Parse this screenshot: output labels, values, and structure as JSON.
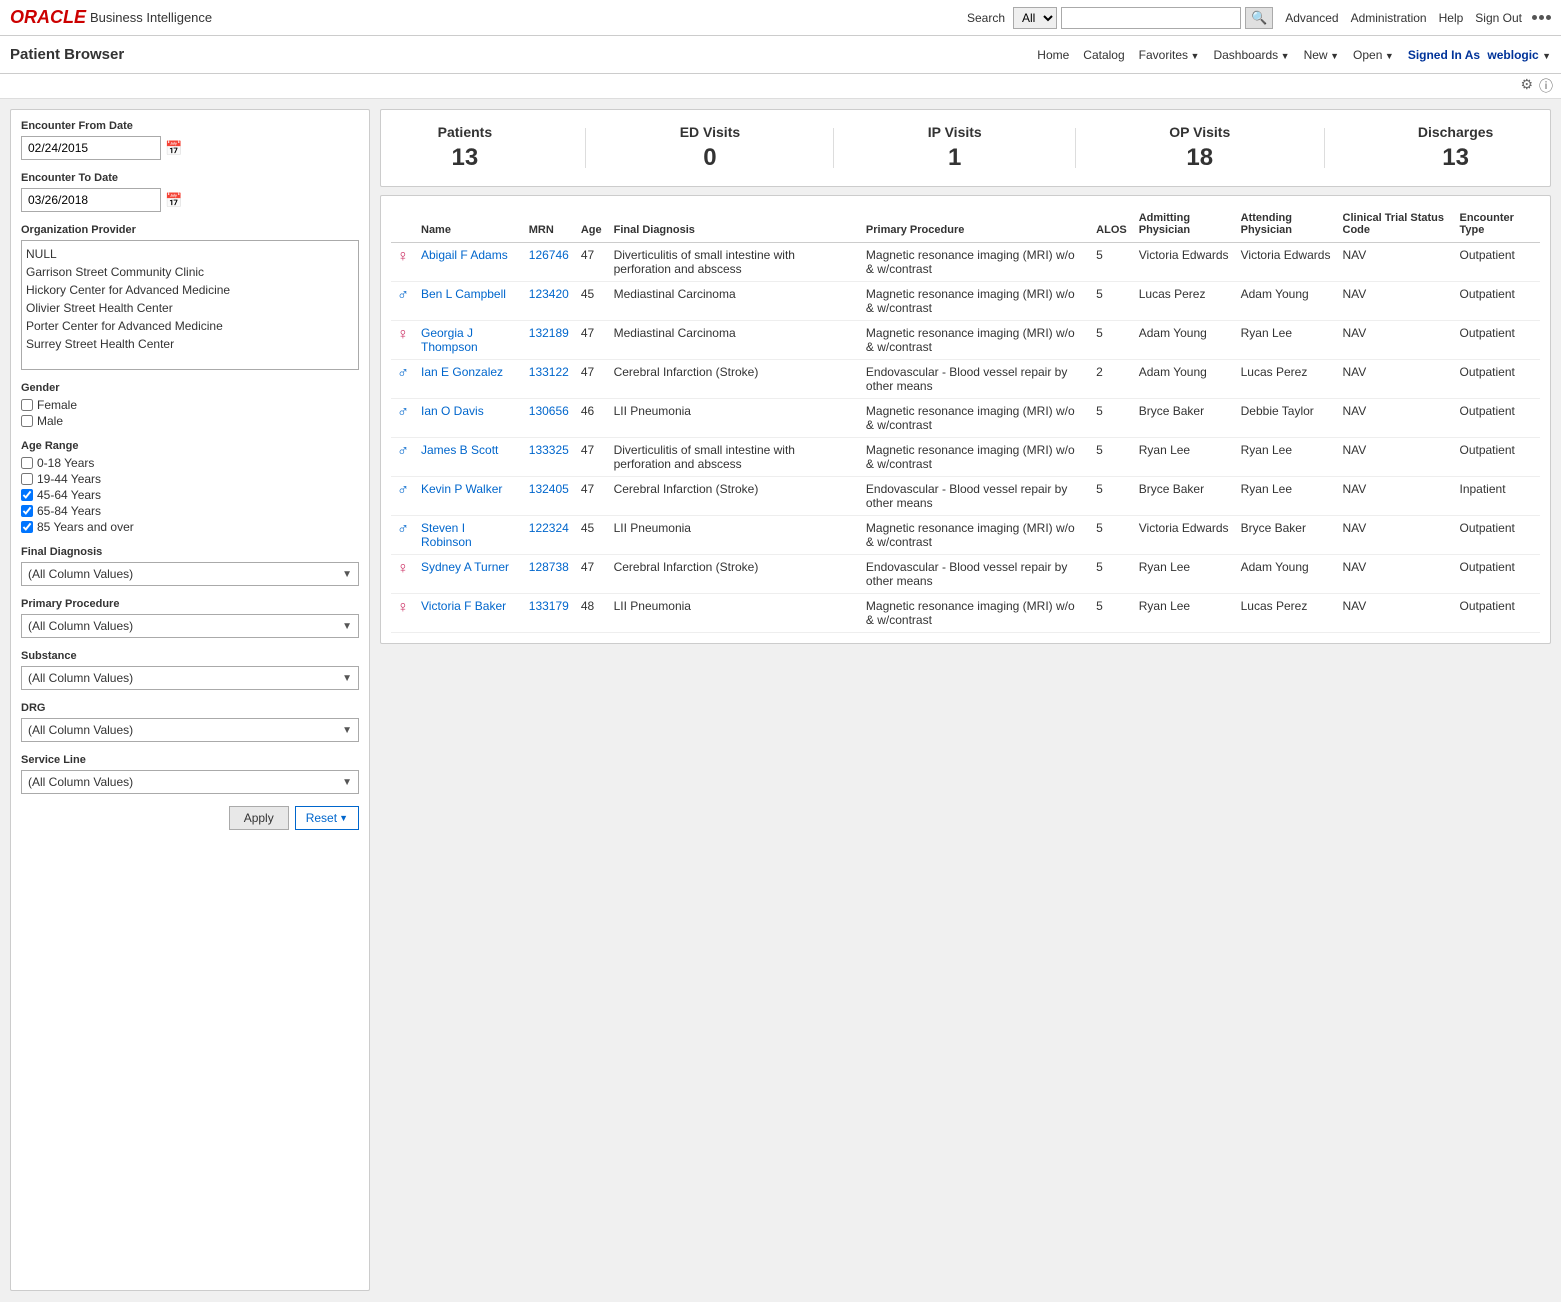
{
  "topNav": {
    "oracleText": "ORACLE",
    "biText": "Business Intelligence",
    "searchLabel": "Search",
    "searchAllOption": "All",
    "advancedLink": "Advanced",
    "administrationLink": "Administration",
    "helpLink": "Help",
    "signOutLink": "Sign Out"
  },
  "secondBar": {
    "pageTitle": "Patient Browser",
    "homeLink": "Home",
    "catalogLink": "Catalog",
    "favoritesLink": "Favorites",
    "dashboardsLink": "Dashboards",
    "newLink": "New",
    "openLink": "Open",
    "signedInLabel": "Signed In As",
    "signedInUser": "weblogic"
  },
  "filters": {
    "encounterFromLabel": "Encounter From Date",
    "encounterFromValue": "02/24/2015",
    "encounterToLabel": "Encounter To Date",
    "encounterToValue": "03/26/2018",
    "orgProviderLabel": "Organization Provider",
    "orgProviders": [
      "NULL",
      "Garrison Street Community Clinic",
      "Hickory Center for Advanced Medicine",
      "Olivier Street Health Center",
      "Porter Center for Advanced Medicine",
      "Surrey Street Health Center"
    ],
    "genderLabel": "Gender",
    "genderFemale": "Female",
    "genderMale": "Male",
    "ageRangeLabel": "Age Range",
    "ageRanges": [
      {
        "label": "0-18 Years",
        "checked": false
      },
      {
        "label": "19-44 Years",
        "checked": false
      },
      {
        "label": "45-64 Years",
        "checked": true
      },
      {
        "label": "65-84 Years",
        "checked": true
      },
      {
        "label": "85 Years and over",
        "checked": true
      }
    ],
    "finalDiagnosisLabel": "Final Diagnosis",
    "finalDiagnosisValue": "(All Column Values)",
    "primaryProcedureLabel": "Primary Procedure",
    "primaryProcedureValue": "(All Column Values)",
    "substanceLabel": "Substance",
    "substanceValue": "(All Column Values)",
    "drgLabel": "DRG",
    "drgValue": "(All Column Values)",
    "serviceLineLabel": "Service Line",
    "serviceLineValue": "(All Column Values)",
    "applyBtn": "Apply",
    "resetBtn": "Reset"
  },
  "stats": {
    "patients": {
      "label": "Patients",
      "value": "13"
    },
    "edVisits": {
      "label": "ED Visits",
      "value": "0"
    },
    "ipVisits": {
      "label": "IP Visits",
      "value": "1"
    },
    "opVisits": {
      "label": "OP Visits",
      "value": "18"
    },
    "discharges": {
      "label": "Discharges",
      "value": "13"
    }
  },
  "tableHeaders": {
    "name": "Name",
    "mrn": "MRN",
    "age": "Age",
    "finalDiagnosis": "Final Diagnosis",
    "primaryProcedure": "Primary Procedure",
    "alos": "ALOS",
    "admittingPhysician": "Admitting Physician",
    "attendingPhysician": "Attending Physician",
    "clinicalTrialStatusCode": "Clinical Trial Status Code",
    "encounterType": "Encounter Type"
  },
  "patients": [
    {
      "gender": "female",
      "name": "Abigail F Adams",
      "mrn": "126746",
      "age": "47",
      "finalDiagnosis": "Diverticulitis of small intestine with perforation and abscess",
      "primaryProcedure": "Magnetic resonance imaging (MRI) w/o & w/contrast",
      "alos": "5",
      "admittingPhysician": "Victoria Edwards",
      "attendingPhysician": "Victoria Edwards",
      "clinicalTrialStatusCode": "NAV",
      "encounterType": "Outpatient"
    },
    {
      "gender": "male",
      "name": "Ben L Campbell",
      "mrn": "123420",
      "age": "45",
      "finalDiagnosis": "Mediastinal Carcinoma",
      "primaryProcedure": "Magnetic resonance imaging (MRI) w/o & w/contrast",
      "alos": "5",
      "admittingPhysician": "Lucas Perez",
      "attendingPhysician": "Adam Young",
      "clinicalTrialStatusCode": "NAV",
      "encounterType": "Outpatient"
    },
    {
      "gender": "female",
      "name": "Georgia J Thompson",
      "mrn": "132189",
      "age": "47",
      "finalDiagnosis": "Mediastinal Carcinoma",
      "primaryProcedure": "Magnetic resonance imaging (MRI) w/o & w/contrast",
      "alos": "5",
      "admittingPhysician": "Adam Young",
      "attendingPhysician": "Ryan Lee",
      "clinicalTrialStatusCode": "NAV",
      "encounterType": "Outpatient"
    },
    {
      "gender": "male",
      "name": "Ian E Gonzalez",
      "mrn": "133122",
      "age": "47",
      "finalDiagnosis": "Cerebral Infarction (Stroke)",
      "primaryProcedure": "Endovascular - Blood vessel repair by other means",
      "alos": "2",
      "admittingPhysician": "Adam Young",
      "attendingPhysician": "Lucas Perez",
      "clinicalTrialStatusCode": "NAV",
      "encounterType": "Outpatient"
    },
    {
      "gender": "male",
      "name": "Ian O Davis",
      "mrn": "130656",
      "age": "46",
      "finalDiagnosis": "LII Pneumonia",
      "primaryProcedure": "Magnetic resonance imaging (MRI) w/o & w/contrast",
      "alos": "5",
      "admittingPhysician": "Bryce Baker",
      "attendingPhysician": "Debbie Taylor",
      "clinicalTrialStatusCode": "NAV",
      "encounterType": "Outpatient"
    },
    {
      "gender": "male",
      "name": "James B Scott",
      "mrn": "133325",
      "age": "47",
      "finalDiagnosis": "Diverticulitis of small intestine with perforation and abscess",
      "primaryProcedure": "Magnetic resonance imaging (MRI) w/o & w/contrast",
      "alos": "5",
      "admittingPhysician": "Ryan Lee",
      "attendingPhysician": "Ryan Lee",
      "clinicalTrialStatusCode": "NAV",
      "encounterType": "Outpatient"
    },
    {
      "gender": "male",
      "name": "Kevin P Walker",
      "mrn": "132405",
      "age": "47",
      "finalDiagnosis": "Cerebral Infarction (Stroke)",
      "primaryProcedure": "Endovascular - Blood vessel repair by other means",
      "alos": "5",
      "admittingPhysician": "Bryce Baker",
      "attendingPhysician": "Ryan Lee",
      "clinicalTrialStatusCode": "NAV",
      "encounterType": "Inpatient"
    },
    {
      "gender": "male",
      "name": "Steven I Robinson",
      "mrn": "122324",
      "age": "45",
      "finalDiagnosis": "LII Pneumonia",
      "primaryProcedure": "Magnetic resonance imaging (MRI) w/o & w/contrast",
      "alos": "5",
      "admittingPhysician": "Victoria Edwards",
      "attendingPhysician": "Bryce Baker",
      "clinicalTrialStatusCode": "NAV",
      "encounterType": "Outpatient"
    },
    {
      "gender": "female",
      "name": "Sydney A Turner",
      "mrn": "128738",
      "age": "47",
      "finalDiagnosis": "Cerebral Infarction (Stroke)",
      "primaryProcedure": "Endovascular - Blood vessel repair by other means",
      "alos": "5",
      "admittingPhysician": "Ryan Lee",
      "attendingPhysician": "Adam Young",
      "clinicalTrialStatusCode": "NAV",
      "encounterType": "Outpatient"
    },
    {
      "gender": "female",
      "name": "Victoria F Baker",
      "mrn": "133179",
      "age": "48",
      "finalDiagnosis": "LII Pneumonia",
      "primaryProcedure": "Magnetic resonance imaging (MRI) w/o & w/contrast",
      "alos": "5",
      "admittingPhysician": "Ryan Lee",
      "attendingPhysician": "Lucas Perez",
      "clinicalTrialStatusCode": "NAV",
      "encounterType": "Outpatient"
    }
  ]
}
